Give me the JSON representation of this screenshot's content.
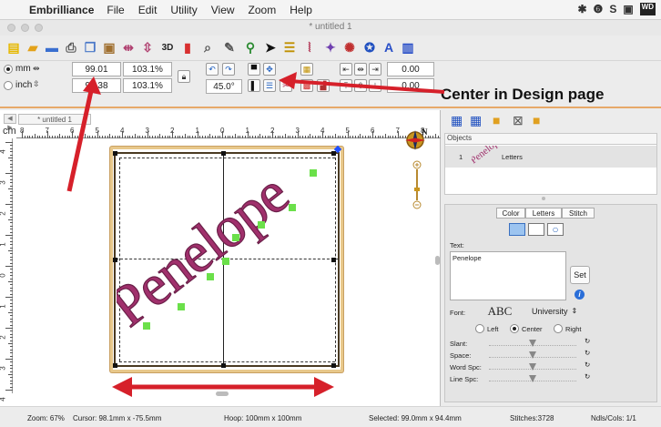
{
  "menubar": {
    "app_name": "Embrilliance",
    "items": [
      "File",
      "Edit",
      "Utility",
      "View",
      "Zoom",
      "Help"
    ],
    "tray_icons": [
      "dropbox-icon",
      "circle-s-icon",
      "s-icon",
      "display-icon",
      "wd-icon"
    ],
    "tray_text": [
      "✱",
      "❻",
      "S",
      "▣",
      "WD"
    ]
  },
  "window": {
    "title": "* untitled 1"
  },
  "toolbar": {
    "tools": [
      {
        "name": "new-icon",
        "glyph": "▤",
        "color": "#e6b800"
      },
      {
        "name": "open-icon",
        "glyph": "▰",
        "color": "#e3a21a"
      },
      {
        "name": "save-icon",
        "glyph": "▬",
        "color": "#3a6fd0"
      },
      {
        "name": "print-icon",
        "glyph": "⎙",
        "color": "#555555"
      },
      {
        "name": "copy-icon",
        "glyph": "❐",
        "color": "#4a78c8"
      },
      {
        "name": "paste-icon",
        "glyph": "▣",
        "color": "#a07030"
      },
      {
        "name": "mirror-icon",
        "glyph": "⇹",
        "color": "#b04070"
      },
      {
        "name": "flip-icon",
        "glyph": "⇳",
        "color": "#b04070"
      },
      {
        "name": "3d-icon",
        "glyph": "3D",
        "color": "#222222"
      },
      {
        "name": "chart-icon",
        "glyph": "▮",
        "color": "#d83030"
      },
      {
        "name": "magnifier-icon",
        "glyph": "⌕",
        "color": "#555555"
      },
      {
        "name": "needle-icon",
        "glyph": "✎",
        "color": "#555555"
      },
      {
        "name": "sewing-icon",
        "glyph": "⚲",
        "color": "#2a8a30"
      },
      {
        "name": "pointer-icon",
        "glyph": "➤",
        "color": "#111111"
      },
      {
        "name": "list-icon",
        "glyph": "☰",
        "color": "#c09000"
      },
      {
        "name": "thread-icon",
        "glyph": "⦚",
        "color": "#b03050"
      },
      {
        "name": "shapes-icon",
        "glyph": "✦",
        "color": "#7040b0"
      },
      {
        "name": "gear-icon",
        "glyph": "✺",
        "color": "#c03030"
      },
      {
        "name": "stamp-icon",
        "glyph": "✪",
        "color": "#2050c0"
      },
      {
        "name": "letter-a-icon",
        "glyph": "A",
        "color": "#2a50c8"
      },
      {
        "name": "book-icon",
        "glyph": "▥",
        "color": "#2a50c8"
      }
    ]
  },
  "props": {
    "unit_mm": "mm",
    "unit_inch": "inch",
    "width_value": "99.01",
    "height_value": "94.38",
    "width_pct": "103.1%",
    "height_pct": "103.1%",
    "rotation": "45.0°",
    "offset_top": "0.00",
    "offset_bottom": "0.00"
  },
  "callout": "Center in Design page",
  "doc": {
    "tab_label": "* untitled 1",
    "ruler_unit": "cm",
    "ruler_h_numbers": [
      "8",
      "7",
      "6",
      "5",
      "4",
      "3",
      "2",
      "1",
      "0",
      "1",
      "2",
      "3",
      "4",
      "5",
      "6",
      "7",
      "8"
    ],
    "ruler_v_numbers": [
      "4",
      "3",
      "2",
      "1",
      "0",
      "1",
      "2",
      "3",
      "4"
    ],
    "lettering_text": "Penelope"
  },
  "objects": {
    "header": "Objects",
    "rows": [
      {
        "index": "1",
        "label": "Letters",
        "thumb": "Penelope"
      }
    ]
  },
  "properties": {
    "tabs": [
      "Color",
      "Letters",
      "Stitch"
    ],
    "active_tab": "Letters",
    "text_label": "Text:",
    "text_value": "Penelope",
    "set_button": "Set",
    "font_label": "Font:",
    "font_sample": "ABC",
    "font_name": "University",
    "align_options": [
      "Left",
      "Center",
      "Right"
    ],
    "align_selected": "Center",
    "sliders": [
      "Slant:",
      "Space:",
      "Word Spc:",
      "Line Spc:"
    ]
  },
  "status": {
    "zoom": "Zoom: 67%",
    "cursor": "Cursor: 98.1mm x -75.5mm",
    "hoop": "Hoop: 100mm x 100mm",
    "selected": "Selected: 99.0mm x 94.4mm",
    "stitches": "Stitches:3728",
    "ndls": "Ndls/Cols: 1/1"
  },
  "colors": {
    "hoop_frame": "#e8c88b",
    "orange_bar": "#e7a969",
    "arrow_red": "#d6202a",
    "lettering": "#a0306c",
    "selection_points": "#6be04a"
  }
}
